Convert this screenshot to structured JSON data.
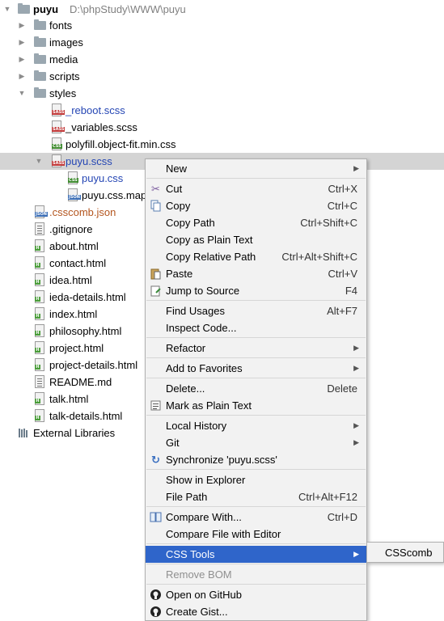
{
  "project": {
    "name": "puyu",
    "path": "D:\\phpStudy\\WWW\\puyu"
  },
  "folders": [
    "fonts",
    "images",
    "media",
    "scripts",
    "styles"
  ],
  "styles_files": [
    "_reboot.scss",
    "_variables.scss",
    "polyfill.object-fit.min.css",
    "puyu.scss"
  ],
  "puyu_children": [
    "puyu.css",
    "puyu.css.map"
  ],
  "root_files": [
    ".csscomb.json",
    ".gitignore",
    "about.html",
    "contact.html",
    "idea.html",
    "ieda-details.html",
    "index.html",
    "philosophy.html",
    "project.html",
    "project-details.html",
    "README.md",
    "talk.html",
    "talk-details.html"
  ],
  "external_libraries": "External Libraries",
  "menu": {
    "new": "New",
    "cut": "Cut",
    "cut_sc": "Ctrl+X",
    "copy": "Copy",
    "copy_sc": "Ctrl+C",
    "copy_path": "Copy Path",
    "copy_path_sc": "Ctrl+Shift+C",
    "copy_plain": "Copy as Plain Text",
    "copy_relative": "Copy Relative Path",
    "copy_relative_sc": "Ctrl+Alt+Shift+C",
    "paste": "Paste",
    "paste_sc": "Ctrl+V",
    "jump_source": "Jump to Source",
    "jump_source_sc": "F4",
    "find_usages": "Find Usages",
    "find_usages_sc": "Alt+F7",
    "inspect_code": "Inspect Code...",
    "refactor": "Refactor",
    "add_favorites": "Add to Favorites",
    "delete": "Delete...",
    "delete_sc": "Delete",
    "mark_plain": "Mark as Plain Text",
    "local_history": "Local History",
    "git": "Git",
    "synchronize": "Synchronize 'puyu.scss'",
    "show_explorer": "Show in Explorer",
    "file_path": "File Path",
    "file_path_sc": "Ctrl+Alt+F12",
    "compare_with": "Compare With...",
    "compare_with_sc": "Ctrl+D",
    "compare_editor": "Compare File with Editor",
    "css_tools": "CSS Tools",
    "remove_bom": "Remove BOM",
    "open_github": "Open on GitHub",
    "create_gist": "Create Gist..."
  },
  "submenu": {
    "csscomb": "CSScomb"
  },
  "colors": {
    "selection": "#2f65ca",
    "menu_bg": "#f2f2f2",
    "row_selected": "#d4d4d4"
  }
}
